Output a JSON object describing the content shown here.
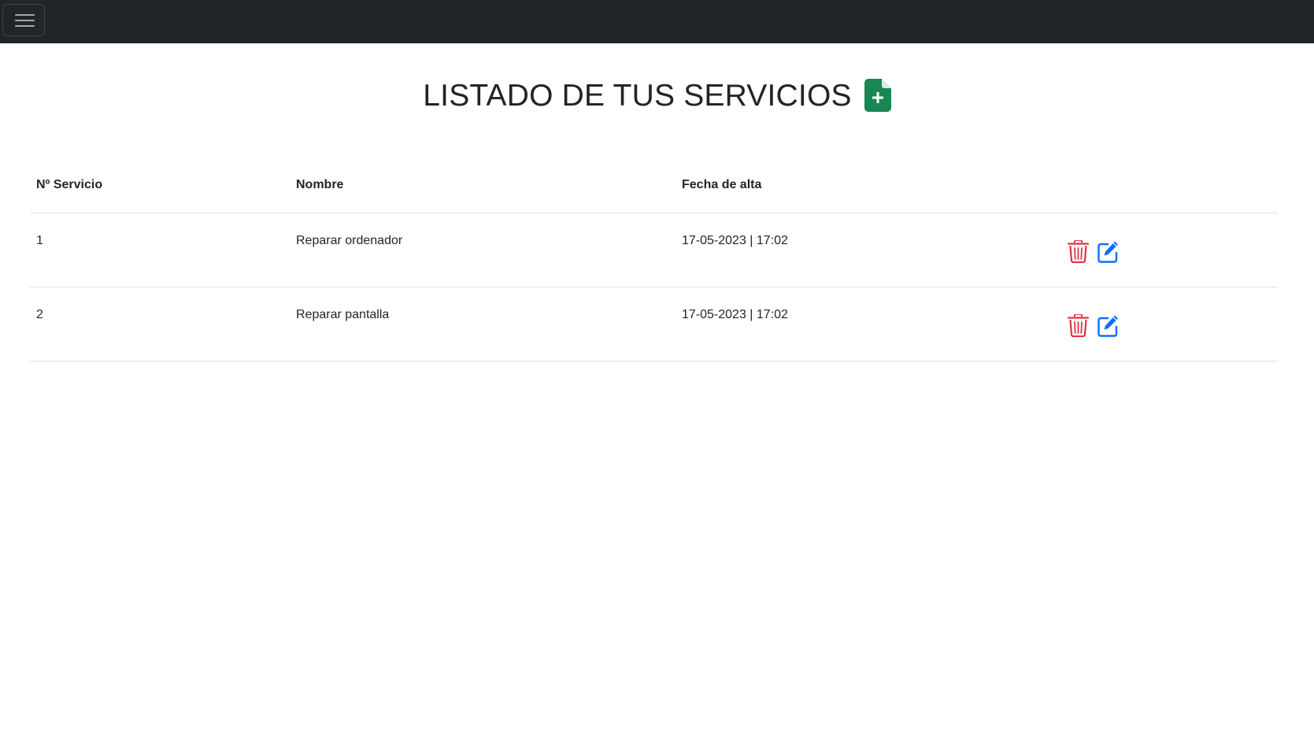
{
  "navbar": {
    "toggle_icon": "hamburger-menu-icon"
  },
  "page": {
    "title": "LISTADO DE TUS SERVICIOS",
    "add_icon": "file-plus-icon",
    "colors": {
      "navbar_bg": "#212529",
      "add": "#198754",
      "delete": "#dc3545",
      "edit": "#0d6efd"
    }
  },
  "table": {
    "headers": {
      "num": "Nº Servicio",
      "name": "Nombre",
      "date": "Fecha de alta"
    },
    "rows": [
      {
        "num": "1",
        "name": "Reparar ordenador",
        "date": "17-05-2023 | 17:02",
        "delete_icon": "trash-icon",
        "edit_icon": "pencil-square-icon"
      },
      {
        "num": "2",
        "name": "Reparar pantalla",
        "date": "17-05-2023 | 17:02",
        "delete_icon": "trash-icon",
        "edit_icon": "pencil-square-icon"
      }
    ]
  }
}
